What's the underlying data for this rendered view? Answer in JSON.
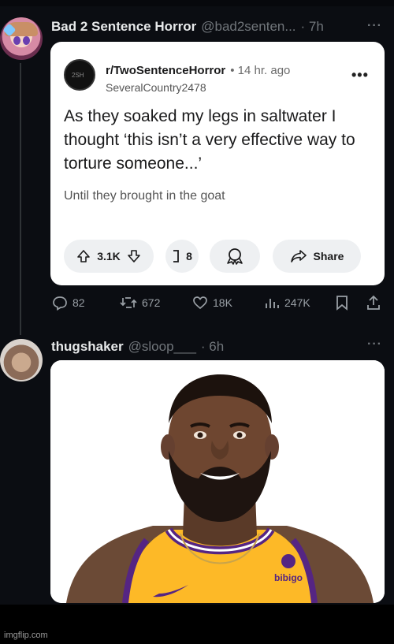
{
  "tweet1": {
    "author_name": "Bad 2 Sentence Horror",
    "author_handle": "@bad2senten...",
    "time": "· 7h",
    "more": "···"
  },
  "reddit_post": {
    "subreddit": "r/TwoSentenceHorror",
    "age": "• 14 hr. ago",
    "username": "SeveralCountry2478",
    "avatar_text": "2SH",
    "title": "As they soaked my legs in saltwater I thought ‘this isn’t a very effective way to torture someone...’",
    "body": "Until they brought in the goat",
    "upvotes": "3.1K",
    "comments": "8",
    "share_label": "Share"
  },
  "tweet1_actions": {
    "replies": "82",
    "reposts": "672",
    "likes": "18K",
    "views": "247K"
  },
  "tweet2": {
    "author_name": "thugshaker",
    "author_handle": "@sloop___",
    "time": "· 6h",
    "more": "···",
    "photo_logo_text": "bibigo"
  },
  "watermark": "imgflip.com",
  "colors": {
    "background": "#0b0d12",
    "secondary_text": "#71767b",
    "jersey_gold": "#fdb927",
    "jersey_purple": "#552583"
  },
  "icons": [
    "upvote-icon",
    "downvote-icon",
    "comment-icon",
    "award-icon",
    "share-icon",
    "reply-icon",
    "repost-icon",
    "like-icon",
    "views-icon",
    "bookmark-icon",
    "share-tweet-icon"
  ]
}
